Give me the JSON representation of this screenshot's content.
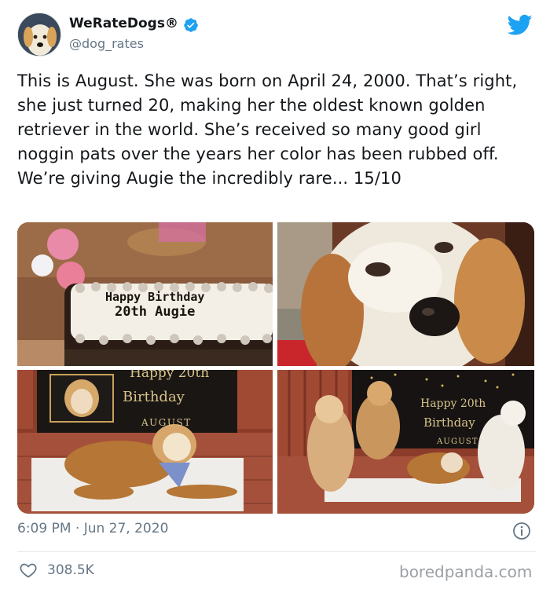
{
  "author": {
    "name": "WeRateDogs®",
    "handle": "@dog_rates"
  },
  "tweet": {
    "text": "This is August. She was born on April 24, 2000. That’s right, she just turned 20, making her the oldest known golden retriever in the world. She’s received so many good girl noggin pats over the years her color has been rubbed off. We’re giving Augie the incredibly rare... 15/10"
  },
  "media": {
    "cake_text_line1": "Happy Birthday",
    "cake_text_line2": "20th Augie",
    "banner1_line1": "Happy 20th",
    "banner1_line2": "Birthday",
    "banner1_line3": "AUGUST",
    "banner2_line1": "Happy 20th",
    "banner2_line2": "Birthday",
    "banner2_line3": "AUGUST"
  },
  "footer": {
    "timestamp": "6:09 PM · Jun 27, 2020",
    "likes": "308.5K",
    "watermark": "boredpanda.com"
  },
  "colors": {
    "brand_blue": "#1da1f2",
    "text_primary": "#14171a",
    "text_secondary": "#657786"
  },
  "icons": [
    "verified-badge-icon",
    "twitter-bird-icon",
    "info-icon",
    "heart-icon"
  ]
}
